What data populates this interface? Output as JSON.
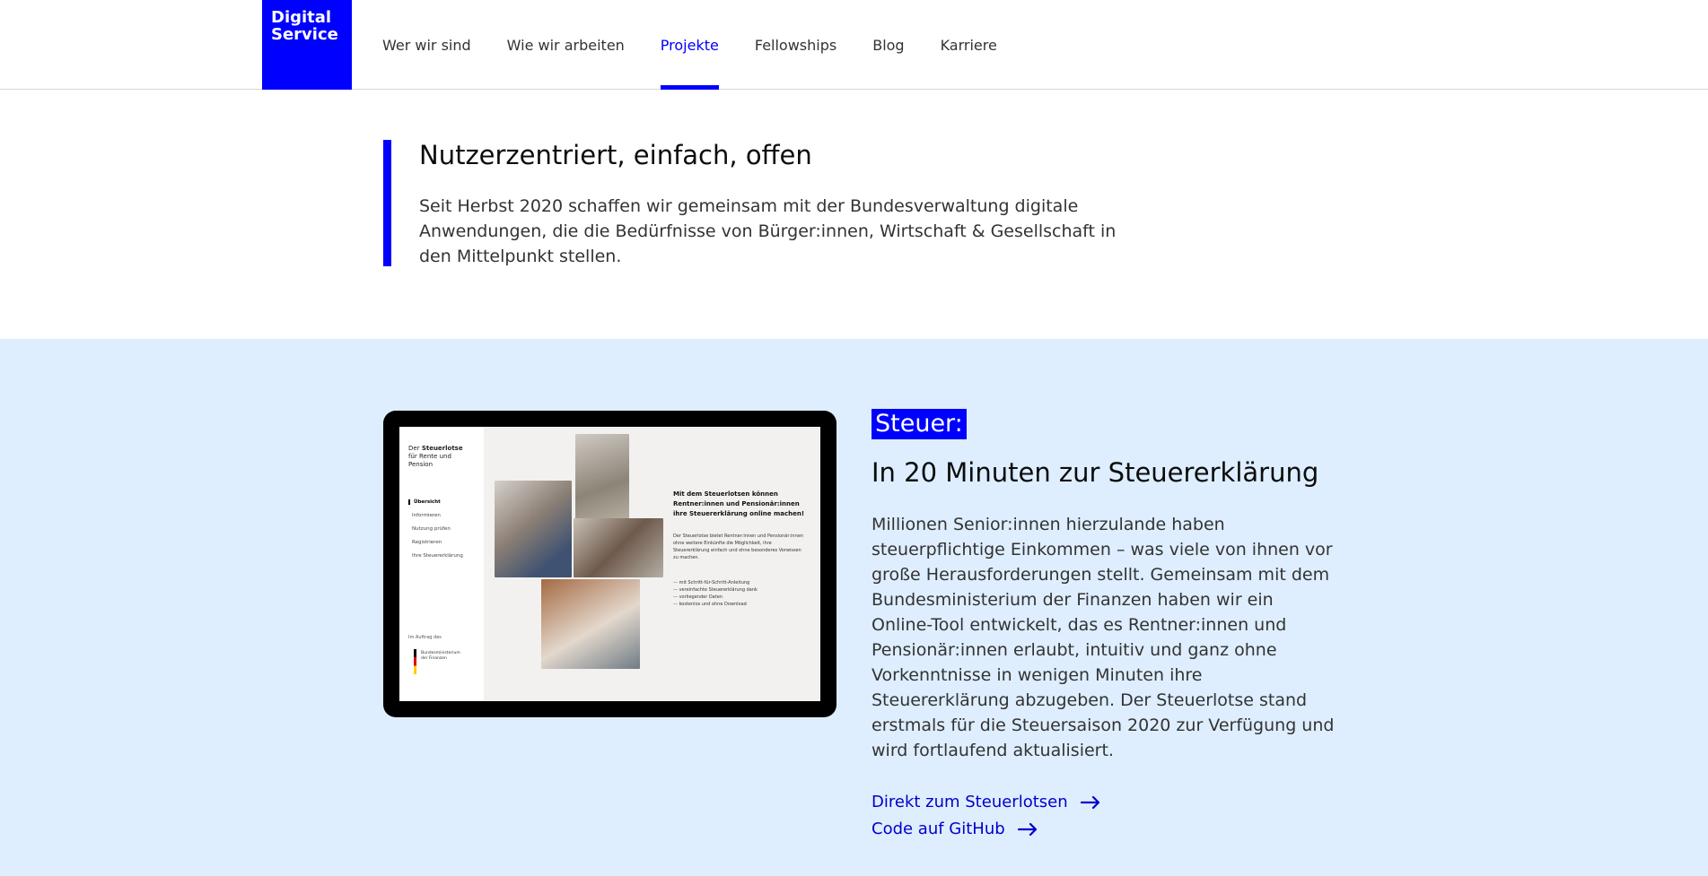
{
  "header": {
    "logo_line1": "Digital",
    "logo_line2": "Service",
    "nav": [
      {
        "label": "Wer wir sind"
      },
      {
        "label": "Wie wir arbeiten"
      },
      {
        "label": "Projekte",
        "active": true
      },
      {
        "label": "Fellowships"
      },
      {
        "label": "Blog"
      },
      {
        "label": "Karriere"
      }
    ]
  },
  "intro": {
    "title": "Nutzerzentriert, einfach, offen",
    "text": "Seit Herbst 2020 schaffen wir gemeinsam mit der Bundesverwaltung digitale Anwendungen, die die Bedürfnisse von Bürger:innen, Wirtschaft & Gesellschaft in den Mittelpunkt stellen."
  },
  "project": {
    "tag": "Steuer:",
    "title": "In 20 Minuten zur Steuererklärung",
    "text": "Millionen Senior:innen hierzulande haben steuerpflichtige Einkommen – was viele von ihnen vor große Herausforderungen stellt. Gemeinsam mit dem Bundesministerium der Finanzen haben wir ein Online-Tool entwickelt, das es Rentner:innen und Pensionär:innen erlaubt, intuitiv und ganz ohne Vorkenntnisse in wenigen Minuten ihre Steuererklärung abzugeben. Der Steuerlotse stand erstmals für die Steuersaison 2020 zur Verfügung und wird fortlaufend aktualisiert.",
    "links": [
      {
        "label": "Direkt zum Steuerlotsen",
        "icon": "arrow-right-icon"
      },
      {
        "label": "Code auf GitHub",
        "icon": "arrow-right-icon"
      }
    ],
    "screenshot": {
      "brand_prefix": "Der ",
      "brand_name": "Steuerlotse",
      "brand_sub": "für Rente und Pension",
      "menu": [
        "Übersicht",
        "Informieren",
        "Nutzung prüfen",
        "Registrieren",
        "Ihre Steuererklärung"
      ],
      "footer_label": "Im Auftrag des",
      "ministry_line1": "Bundesministerium",
      "ministry_line2": "der Finanzen",
      "headline": "Mit dem Steuerlotsen können Rentner:innen und Pensionär:innen ihre Steuererklärung online machen!",
      "body": "Der Steuerlotse bietet Rentner:innen und Pensionär:innen ohne weitere Einkünfte die Möglichkeit, ihre Steuererklärung einfach und ohne besonderes Vorwissen zu machen.",
      "bullets": [
        "mit Schritt-für-Schritt-Anleitung",
        "vereinfachte Steuererklärung dank",
        "vorliegender Daten",
        "kostenlos und ohne Download"
      ]
    }
  },
  "colors": {
    "brand_blue": "#0000ff",
    "section_bg": "#deeeff",
    "link_blue": "#0000cc"
  }
}
